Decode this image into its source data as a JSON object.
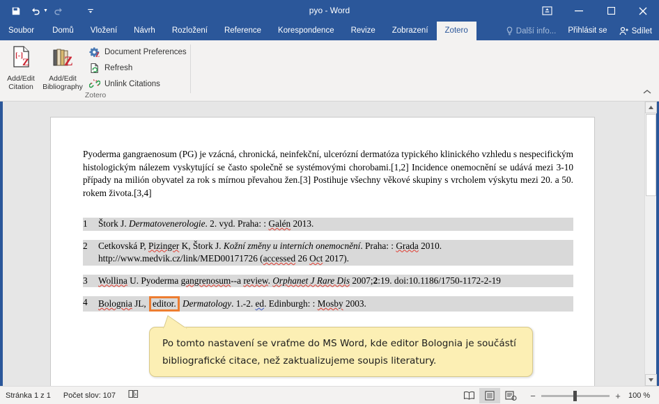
{
  "window": {
    "title": "pyo - Word",
    "quick_access": [
      {
        "name": "save-icon",
        "label": "Uložit"
      },
      {
        "name": "undo-icon",
        "label": "Zpět"
      },
      {
        "name": "redo-icon",
        "label": "Znovu"
      },
      {
        "name": "customize-quick-access-icon",
        "label": "Přizpůsobit panel nástrojů Rychlý přístup"
      }
    ],
    "controls": {
      "ribbon_display_options": "Možnosti zobrazení pásu karet",
      "minimize": "Minimalizovat",
      "maximize": "Maximalizovat",
      "close": "Zavřít"
    }
  },
  "tabs": [
    {
      "label": "Soubor",
      "active": false
    },
    {
      "label": "Domů",
      "active": false
    },
    {
      "label": "Vložení",
      "active": false
    },
    {
      "label": "Návrh",
      "active": false
    },
    {
      "label": "Rozložení",
      "active": false
    },
    {
      "label": "Reference",
      "active": false
    },
    {
      "label": "Korespondence",
      "active": false
    },
    {
      "label": "Revize",
      "active": false
    },
    {
      "label": "Zobrazení",
      "active": false
    },
    {
      "label": "Zotero",
      "active": true
    }
  ],
  "tabbar_right": {
    "tell_me": "Další info...",
    "sign_in": "Přihlásit se",
    "share": "Sdílet"
  },
  "ribbon": {
    "group_label": "Zotero",
    "big_buttons": [
      {
        "label_line1": "Add/Edit",
        "label_line2": "Citation",
        "icon": "add-edit-citation-icon"
      },
      {
        "label_line1": "Add/Edit",
        "label_line2": "Bibliography",
        "icon": "add-edit-bibliography-icon"
      }
    ],
    "small_buttons": [
      {
        "label": "Document Preferences",
        "icon": "document-preferences-icon"
      },
      {
        "label": "Refresh",
        "icon": "refresh-icon"
      },
      {
        "label": "Unlink Citations",
        "icon": "unlink-citations-icon"
      }
    ],
    "collapse_label": "Sbalit pás karet"
  },
  "document": {
    "paragraph": "Pyoderma gangraenosum (PG) je vzácná, chronická, neinfekční, ulcerózní dermatóza typického klinického vzhledu s nespecifickým histologickým nálezem vyskytující se často společně se systémovými chorobami.[1,2] Incidence onemocnění se udává mezi 3-10 případy na milión obyvatel za rok s mírnou převahou žen.[3] Postihuje všechny věkové skupiny s vrcholem výskytu mezi 20. a 50. rokem života.[3,4]",
    "bibliography": [
      {
        "number": "1",
        "parts": [
          {
            "text": "Štork J. ",
            "style": "normal"
          },
          {
            "text": "Dermatovenerologie",
            "style": "italic"
          },
          {
            "text": ". 2. vyd. Praha: : ",
            "style": "normal"
          },
          {
            "text": "Galén",
            "style": "spell-red"
          },
          {
            "text": " 2013.",
            "style": "normal"
          }
        ]
      },
      {
        "number": "2",
        "parts": [
          {
            "text": "Cetkovská P, ",
            "style": "normal"
          },
          {
            "text": "Pizinger",
            "style": "spell-red"
          },
          {
            "text": " K, Štork J. ",
            "style": "normal"
          },
          {
            "text": "Kožní změny u interních onemocnění",
            "style": "italic"
          },
          {
            "text": ". Praha: : ",
            "style": "normal"
          },
          {
            "text": "Grada",
            "style": "spell-red"
          },
          {
            "text": " 2010. http://www.medvik.cz/link/MED00171726 (",
            "style": "normal"
          },
          {
            "text": "accessed",
            "style": "spell-red"
          },
          {
            "text": " 26 ",
            "style": "normal"
          },
          {
            "text": "Oct",
            "style": "spell-red"
          },
          {
            "text": " 2017).",
            "style": "normal"
          }
        ]
      },
      {
        "number": "3",
        "parts": [
          {
            "text": "Wollina",
            "style": "spell-red"
          },
          {
            "text": " U. Pyoderma ",
            "style": "normal"
          },
          {
            "text": "gangrenosum",
            "style": "spell-red"
          },
          {
            "text": "--a ",
            "style": "normal"
          },
          {
            "text": "review",
            "style": "spell-red"
          },
          {
            "text": ". ",
            "style": "normal"
          },
          {
            "text": "Orphanet J Rare Dis",
            "style": "italic-spell-red"
          },
          {
            "text": " 2007;",
            "style": "normal"
          },
          {
            "text": "2",
            "style": "bold"
          },
          {
            "text": ":19. doi:10.1186/1750-1172-2-19",
            "style": "normal"
          }
        ]
      },
      {
        "number": "4",
        "parts": [
          {
            "text": "Bolognia",
            "style": "spell-red"
          },
          {
            "text": " JL, ",
            "style": "normal"
          },
          {
            "text": "editor.",
            "style": "highlight"
          },
          {
            "text": " ",
            "style": "normal"
          },
          {
            "text": "Dermatology",
            "style": "italic"
          },
          {
            "text": ". 1.-2. ",
            "style": "normal"
          },
          {
            "text": "ed",
            "style": "spell-blue"
          },
          {
            "text": ". Edinburgh: : ",
            "style": "normal"
          },
          {
            "text": "Mosby",
            "style": "spell-red"
          },
          {
            "text": " 2003.",
            "style": "normal"
          }
        ]
      }
    ]
  },
  "callout": {
    "text": "Po tomto nastavení se vraťme do MS Word, kde editor Bolognia je součástí bibliografické citace, než zaktualizujeme soupis literatury."
  },
  "statusbar": {
    "page": "Stránka 1 z 1",
    "word_count": "Počet slov: 107",
    "proofing_icon": "proofing-errors-icon",
    "views": [
      {
        "name": "read-mode-view-button",
        "active": false
      },
      {
        "name": "print-layout-view-button",
        "active": true
      },
      {
        "name": "web-layout-view-button",
        "active": false
      }
    ],
    "zoom_out": "−",
    "zoom_in": "+",
    "zoom_percent": "100 %"
  },
  "colors": {
    "word_blue": "#2b579a",
    "ribbon_bg": "#f3f2f1",
    "workspace_gray": "#e6e6e6",
    "highlight_orange": "#ed7d31",
    "callout_yellow": "#fcefb4",
    "field_shading": "#d9d9d9",
    "zotero_red": "#cc2936"
  }
}
